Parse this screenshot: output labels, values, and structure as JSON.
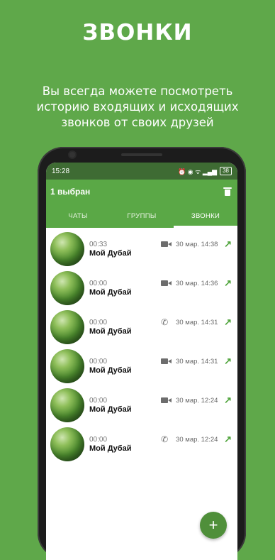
{
  "promo": {
    "title": "ЗВОНКИ",
    "subtitle": "Вы всегда можете посмотреть историю входящих и исходящих звонков от своих друзей"
  },
  "status_bar": {
    "time": "15:28",
    "icons": "⏰ ◉ ᯤ ▂▄▆ ",
    "battery": "38"
  },
  "app_bar": {
    "title": "1 выбран",
    "delete_icon": "trash-icon"
  },
  "tabs": [
    {
      "label": "ЧАТЫ",
      "active": false
    },
    {
      "label": "ГРУППЫ",
      "active": false
    },
    {
      "label": "ЗВОНКИ",
      "active": true
    }
  ],
  "calls": [
    {
      "duration": "00:33",
      "name": "Мой Дубай",
      "type": "video",
      "datetime": "30 мар. 14:38",
      "direction": "↗"
    },
    {
      "duration": "00:00",
      "name": "Мой Дубай",
      "type": "video",
      "datetime": "30 мар. 14:36",
      "direction": "↗"
    },
    {
      "duration": "00:00",
      "name": "Мой Дубай",
      "type": "voice",
      "datetime": "30 мар. 14:31",
      "direction": "↗"
    },
    {
      "duration": "00:00",
      "name": "Мой Дубай",
      "type": "video",
      "datetime": "30 мар. 14:31",
      "direction": "↗"
    },
    {
      "duration": "00:00",
      "name": "Мой Дубай",
      "type": "video",
      "datetime": "30 мар. 12:24",
      "direction": "↗"
    },
    {
      "duration": "00:00",
      "name": "Мой Дубай",
      "type": "voice",
      "datetime": "30 мар. 12:24",
      "direction": "↗"
    }
  ],
  "fab": {
    "label": "+"
  },
  "colors": {
    "background": "#5fa84a",
    "appbar": "#5aa846",
    "statusbar": "#3e6b33",
    "accent_arrow": "#4ea33a"
  }
}
